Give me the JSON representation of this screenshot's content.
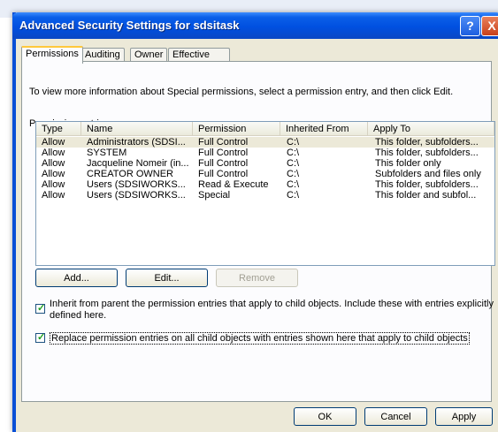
{
  "window": {
    "title": "Advanced Security Settings for sdsitask",
    "help_label": "?",
    "close_label": "X"
  },
  "tabs": [
    {
      "label": "Permissions"
    },
    {
      "label": "Auditing"
    },
    {
      "label": "Owner"
    },
    {
      "label": "Effective Permissions"
    }
  ],
  "info_text": "To view more information about Special permissions, select a permission entry, and then click Edit.",
  "entries_label": "Permission entries:",
  "table": {
    "headers": [
      "Type",
      "Name",
      "Permission",
      "Inherited From",
      "Apply To"
    ],
    "rows": [
      [
        "Allow",
        "Administrators (SDSI...",
        "Full Control",
        "C:\\",
        "This folder, subfolders..."
      ],
      [
        "Allow",
        "SYSTEM",
        "Full Control",
        "C:\\",
        "This folder, subfolders..."
      ],
      [
        "Allow",
        "Jacqueline Nomeir (in...",
        "Full Control",
        "C:\\",
        "This folder only"
      ],
      [
        "Allow",
        "CREATOR OWNER",
        "Full Control",
        "C:\\",
        "Subfolders and files only"
      ],
      [
        "Allow",
        "Users (SDSIWORKS...",
        "Read & Execute",
        "C:\\",
        "This folder, subfolders..."
      ],
      [
        "Allow",
        "Users (SDSIWORKS...",
        "Special",
        "C:\\",
        "This folder and subfol..."
      ]
    ]
  },
  "buttons": {
    "add": "Add...",
    "edit": "Edit...",
    "remove": "Remove",
    "ok": "OK",
    "cancel": "Cancel",
    "apply": "Apply"
  },
  "inherit_checkbox": {
    "checked": true,
    "line1": "Inherit from parent the permission entries that apply to child objects. Include these with entries explicitly",
    "line2": "defined here."
  },
  "replace_checkbox": {
    "checked": true,
    "text": "Replace permission entries on all child objects with entries shown here that apply to child objects"
  },
  "colors": {
    "titlebar": "#0050e0",
    "dialog_bg": "#ece9d8",
    "check": "#21a121"
  }
}
